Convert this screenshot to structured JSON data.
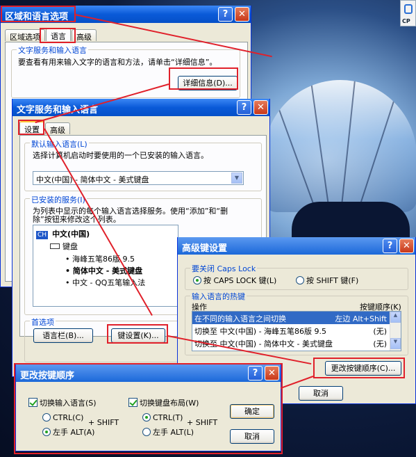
{
  "regional": {
    "title": "区域和语言选项",
    "tabs": [
      "区域选项",
      "语言",
      "高级"
    ],
    "group": "文字服务和输入语言",
    "desc": "要查看有用来输入文字的语言和方法，请单击“详细信息”。",
    "details_btn": "详细信息(D)..."
  },
  "text_services": {
    "title": "文字服务和输入语言",
    "tabs": [
      "设置",
      "高级"
    ],
    "default_group": "默认输入语言(L)",
    "default_desc": "选择计算机启动时要使用的一个已安装的输入语言。",
    "default_value": "中文(中国) - 简体中文 - 美式键盘",
    "installed_group": "已安装的服务(I)",
    "installed_desc1": "为列表中显示的每个输入语言选择服务。使用“添加”和“删",
    "installed_desc2": "除”按钮来修改这个列表。",
    "lang": "中文(中国)",
    "keyboard": "键盘",
    "ime1": "海峰五笔86版 9.5",
    "ime2": "简体中文 - 美式键盘",
    "ime3": "中文 - QQ五笔输入法",
    "lang_badge": "CH",
    "pref_group": "首选项",
    "langbar_btn": "语言栏(B)...",
    "keyset_btn": "键设置(K)..."
  },
  "advanced": {
    "title": "高级键设置",
    "caps_group": "要关闭 Caps Lock",
    "caps_opt1": "按 CAPS LOCK 键(L)",
    "caps_opt2": "按 SHIFT 键(F)",
    "hotkey_group": "输入语言的热键",
    "col_action": "操作",
    "col_seq": "按键顺序(K)",
    "rows": [
      {
        "action": "在不同的输入语言之间切换",
        "seq": "左边 Alt+Shift"
      },
      {
        "action": "切换至 中文(中国) - 海峰五笔86版 9.5",
        "seq": "(无)"
      },
      {
        "action": "切换至 中文(中国) - 简体中文 - 美式键盘",
        "seq": "(无)"
      }
    ],
    "change_btn": "更改按键顺序(C)...",
    "cancel_btn": "取消"
  },
  "change": {
    "title": "更改按键顺序",
    "chk_lang": "切换输入语言(S)",
    "chk_kbd": "切换键盘布局(W)",
    "ctrl_left": "CTRL(C)",
    "alt_left": "左手 ALT(A)",
    "ctrl_right": "CTRL(T)",
    "alt_right": "左手 ALT(L)",
    "plus_shift": "+ SHIFT",
    "ok_btn": "确定",
    "cancel_btn": "取消"
  },
  "brand": "CP"
}
